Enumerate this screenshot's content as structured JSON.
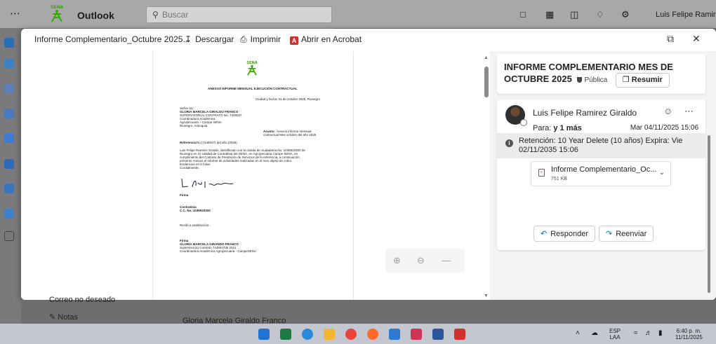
{
  "outlook": {
    "app_name": "Outlook",
    "search_placeholder": "Buscar",
    "user_name": "Luis Felipe Ramire..."
  },
  "background": {
    "left_item": "Correo no deseado",
    "notes_item": "Notas",
    "list_sender": "Gloria Marcela Giraldo Franco"
  },
  "viewer": {
    "file_title": "Informe Complementario_Octubre 2025...",
    "download_label": "Descargar",
    "print_label": "Imprimir",
    "acrobat_label": "Abrir en Acrobat",
    "acrobat_glyph": "A"
  },
  "document": {
    "heading": "ANEXOS INFORME MENSUAL EJECUCIÓN CONTRACTUAL",
    "city_date": "Ciudad y fecha: 31 de octubre 2025, Rionegro",
    "salutation": "Señor (a)",
    "recipient": "GLORIA MARCELA GIRALDO FRANCO",
    "contract_line": "SUPERVISOR(A) CONTRATO No. 7448037",
    "role_line": "Coordinadora Académica",
    "unit_line": "Agropecuaria – Campe SENA",
    "place_line": "Rionegro, Antioquia",
    "asunto_label": "Asunto:",
    "asunto_line1": "Anexos informe mensual",
    "asunto_line2": "contractual Mes octubre del año 2025",
    "reference_label": "Referencia:",
    "reference_value": "No (7448037) del año (2025)",
    "body_lines": [
      "Luis Felipe Ramirez Giraldo, identificado con la cédula de ciudadanía No. 1036933300 de",
      "Rionegro en mi calidad de Contratista del SENA, en Agropecuaria Campe SENA, en",
      "cumplimiento del Contrato de Prestación de Servicios de la referencia, a continuación,",
      "presento Anexos el informe de actividades realizadas en el mes objeto de cobro.",
      "Evidencias en 5 folios",
      "Cordialmente,"
    ],
    "firma_label": "Firma",
    "contratista_label": "Contratista",
    "cc_line": "C.C. No. 1036933300",
    "recibi_line": "Recibí a satisfacción:",
    "firma2_label": "Firma",
    "supervisor_name": "GLORIA MARCELA GIRANDO FRANCO",
    "supervisor_contract": "Supervisor(a) Contrato 7448037de 2021",
    "supervisor_role": "Coordinadora Académica Agropecuaria - CampeSENA",
    "logo_text": "SENA"
  },
  "details": {
    "subject": "INFORME COMPLEMENTARIO MES DE OCTUBRE 2025",
    "visibility": "Pública",
    "summarize_label": "Resumir",
    "sender": "Luis Felipe Ramirez Giraldo",
    "to_label": "Para:",
    "to_value": "y 1 más",
    "date": "Mar 04/11/2025 15:06",
    "retention": "Retención: 10 Year Delete (10 años) Expira: Vie 02/11/2035 15:06",
    "retention_glyph": "i",
    "attachment_name": "Informe Complementario_Oc...",
    "attachment_size": "751 KB",
    "reply_label": "Responder",
    "forward_label": "Reenviar"
  },
  "taskbar": {
    "lang_top": "ESP",
    "lang_bottom": "LAA",
    "time": "6:40 p. m.",
    "date": "11/11/2025"
  },
  "colors": {
    "sena_green": "#39a900",
    "accent": "#0f6cbd"
  }
}
